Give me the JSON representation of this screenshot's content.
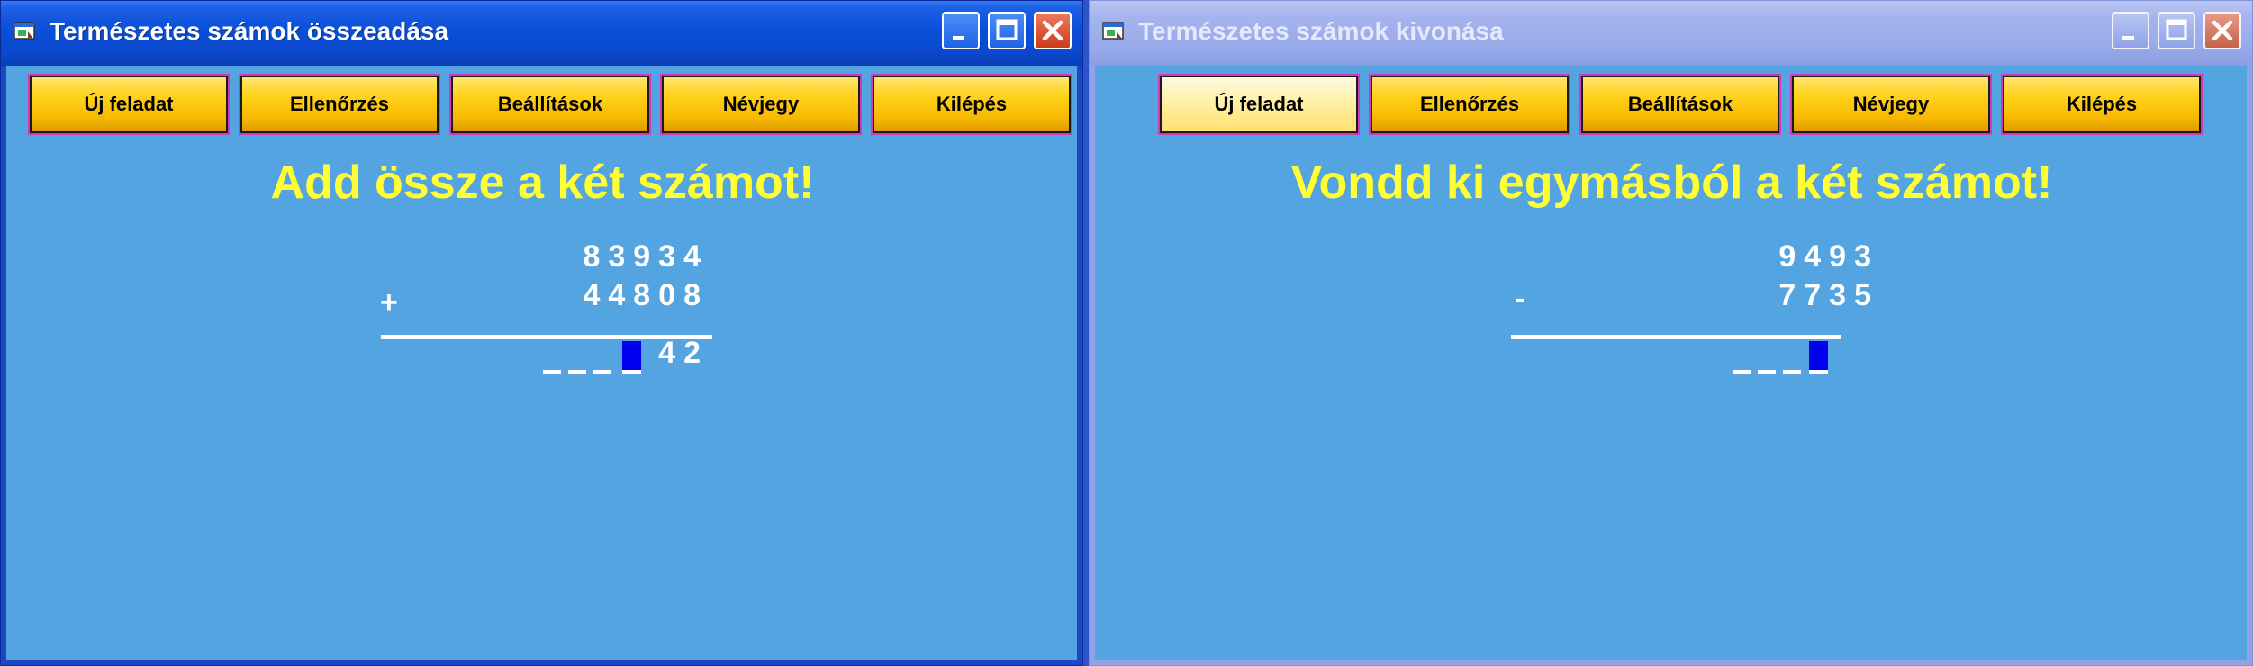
{
  "windows": [
    {
      "title": "Természetes számok összeadása",
      "buttons": [
        "Új feladat",
        "Ellenőrzés",
        "Beállítások",
        "Névjegy",
        "Kilépés"
      ],
      "heading": "Add össze a két számot!",
      "operand1": "83934",
      "operand2": "44808",
      "operator": "+",
      "answer_digits": "42"
    },
    {
      "title": "Természetes számok kivonása",
      "buttons": [
        "Új feladat",
        "Ellenőrzés",
        "Beállítások",
        "Névjegy",
        "Kilépés"
      ],
      "heading": "Vondd ki egymásból a két számot!",
      "operand1": "9493",
      "operand2": "7735",
      "operator": "-",
      "answer_digits": ""
    }
  ],
  "icons": [
    "app-icon",
    "minimize-icon",
    "maximize-icon",
    "close-icon"
  ],
  "colors": {
    "client_background": "#55a4e2",
    "heading_yellow": "#ffff33",
    "button_gold": "#ffd21a",
    "active_titlebar": "#0a4fd9",
    "inactive_titlebar": "#98aae9",
    "input_cursor_blue": "#0000f0"
  }
}
